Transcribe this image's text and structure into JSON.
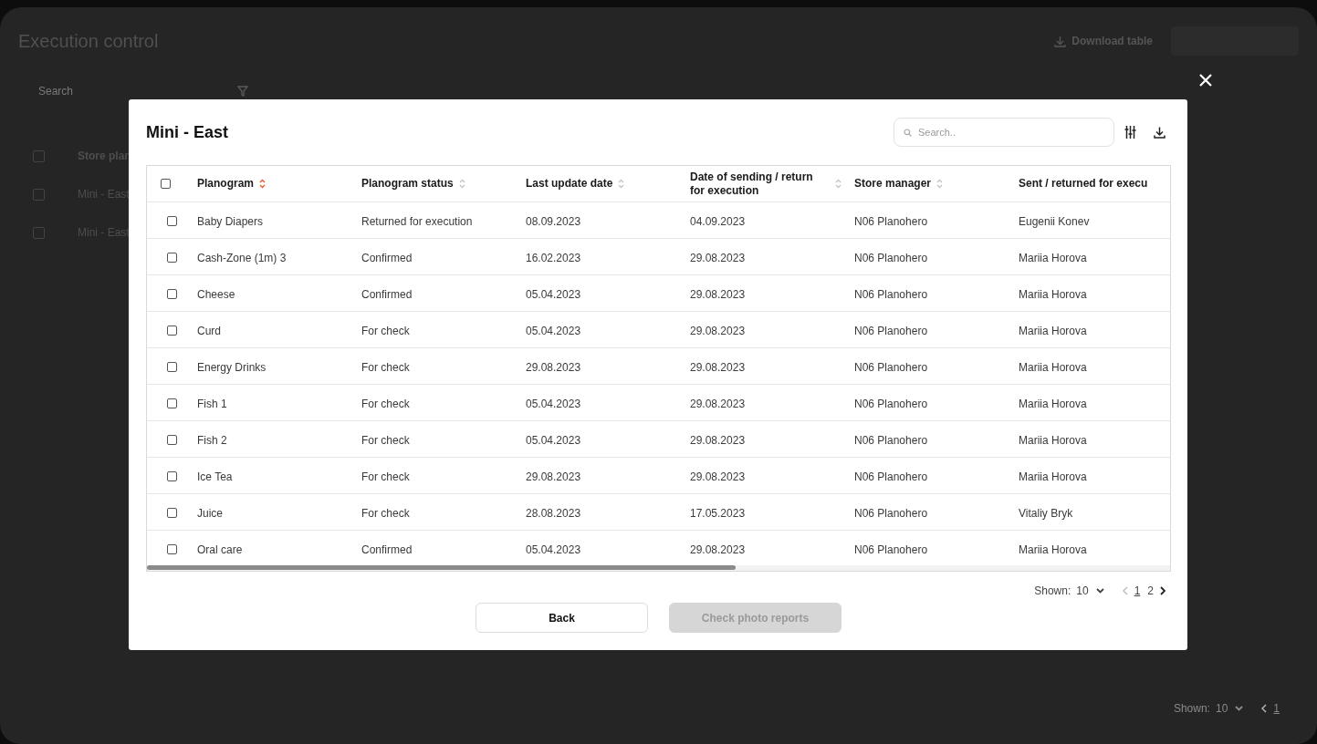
{
  "background": {
    "title": "Execution control",
    "download_button": "Download table",
    "search_placeholder": "Search",
    "table": {
      "select_all_checked": false,
      "columns": [
        "Store plan"
      ],
      "rows": [
        {
          "selected": false,
          "cells": [
            "Mini - East"
          ]
        },
        {
          "selected": false,
          "cells": [
            "Mini - East"
          ]
        }
      ]
    },
    "pagination": {
      "shown_label": "Shown:",
      "page_size": "10",
      "pages": [
        {
          "label": "1",
          "selected": true
        }
      ]
    }
  },
  "modal": {
    "title": "Mini - East",
    "search_placeholder": "Search..",
    "select_all_checked": false,
    "columns": [
      {
        "label": "Planogram",
        "sorted": true
      },
      {
        "label": "Planogram status",
        "sorted": false
      },
      {
        "label": "Last update date",
        "sorted": false
      },
      {
        "label": "Date of sending / return for execution",
        "sorted": false
      },
      {
        "label": "Store manager",
        "sorted": false
      },
      {
        "label": "Sent / returned for execu"
      }
    ],
    "rows": [
      {
        "selected": false,
        "cells": [
          "Baby Diapers",
          "Returned for execution",
          "08.09.2023",
          "04.09.2023",
          "N06 Planohero",
          "Eugenii Konev"
        ]
      },
      {
        "selected": false,
        "cells": [
          "Cash-Zone (1m) 3",
          "Confirmed",
          "16.02.2023",
          "29.08.2023",
          "N06 Planohero",
          "Mariia Horova"
        ]
      },
      {
        "selected": false,
        "cells": [
          "Cheese",
          "Confirmed",
          "05.04.2023",
          "29.08.2023",
          "N06 Planohero",
          "Mariia Horova"
        ]
      },
      {
        "selected": false,
        "cells": [
          "Curd",
          "For check",
          "05.04.2023",
          "29.08.2023",
          "N06 Planohero",
          "Mariia Horova"
        ]
      },
      {
        "selected": false,
        "cells": [
          "Energy Drinks",
          "For check",
          "29.08.2023",
          "29.08.2023",
          "N06 Planohero",
          "Mariia Horova"
        ]
      },
      {
        "selected": false,
        "cells": [
          "Fish 1",
          "For check",
          "05.04.2023",
          "29.08.2023",
          "N06 Planohero",
          "Mariia Horova"
        ]
      },
      {
        "selected": false,
        "cells": [
          "Fish 2",
          "For check",
          "05.04.2023",
          "29.08.2023",
          "N06 Planohero",
          "Mariia Horova"
        ]
      },
      {
        "selected": false,
        "cells": [
          "Ice Tea",
          "For check",
          "29.08.2023",
          "29.08.2023",
          "N06 Planohero",
          "Mariia Horova"
        ]
      },
      {
        "selected": false,
        "cells": [
          "Juice",
          "For check",
          "28.08.2023",
          "17.05.2023",
          "N06 Planohero",
          "Vitaliy Bryk"
        ]
      },
      {
        "selected": false,
        "cells": [
          "Oral care",
          "Confirmed",
          "05.04.2023",
          "29.08.2023",
          "N06 Planohero",
          "Mariia Horova"
        ]
      }
    ],
    "pagination": {
      "shown_label": "Shown:",
      "page_size": "10",
      "pages": [
        {
          "label": "1",
          "selected": true
        },
        {
          "label": "2",
          "selected": false
        }
      ]
    },
    "buttons": [
      {
        "label": "Back",
        "disabled": false
      },
      {
        "label": "Check photo reports",
        "disabled": true
      }
    ]
  }
}
